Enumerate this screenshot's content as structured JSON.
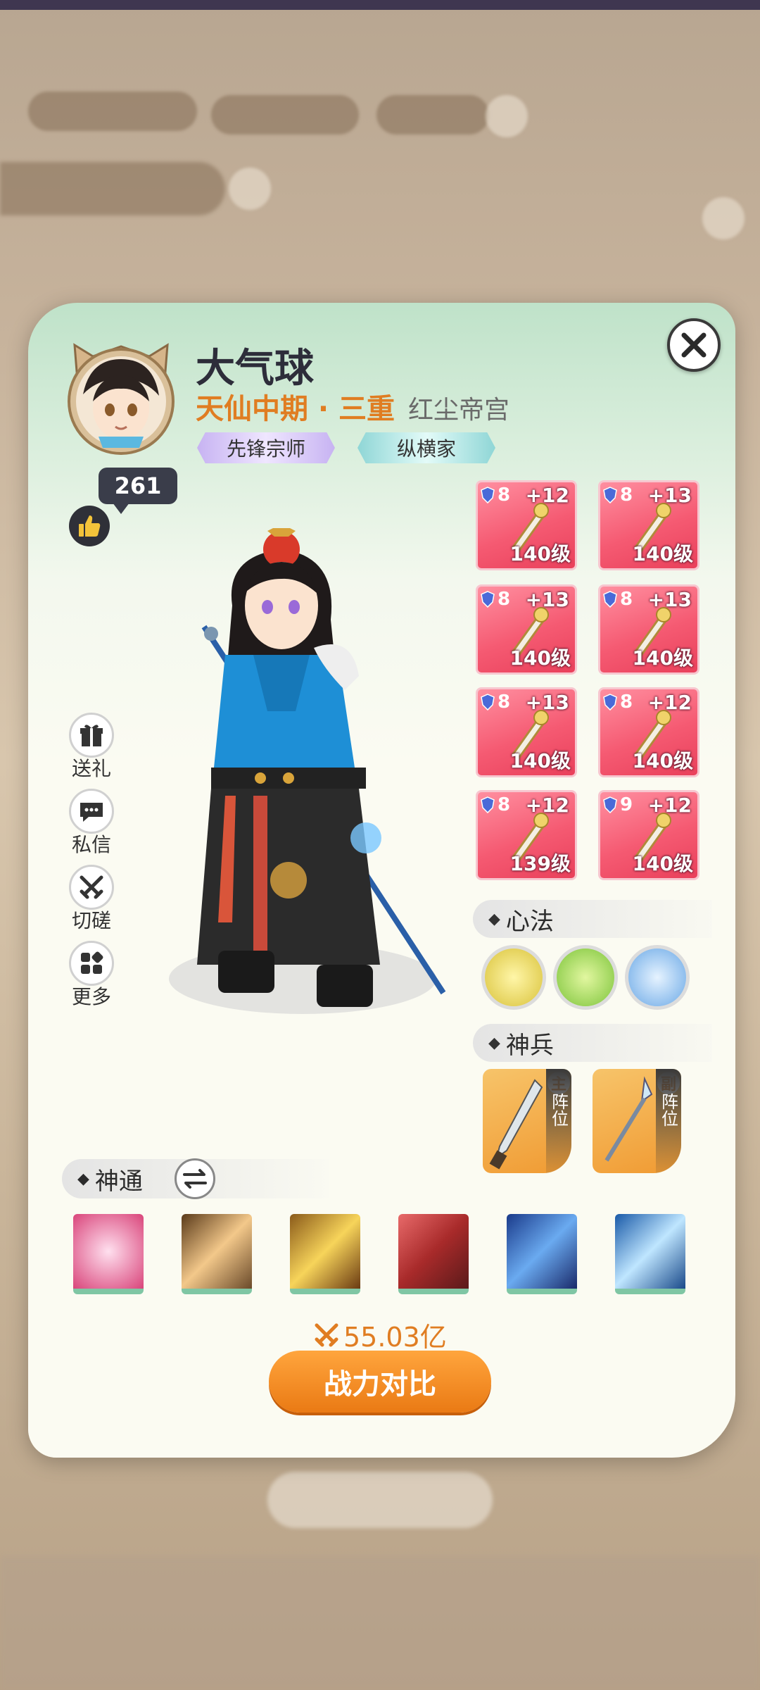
{
  "player": {
    "name": "大气球",
    "realm": "天仙中期 · 三重",
    "sect": "红尘帝宫",
    "tags": [
      "先锋宗师",
      "纵横家"
    ],
    "likes": "261"
  },
  "side_actions": [
    {
      "label": "送礼",
      "icon": "gift-icon"
    },
    {
      "label": "私信",
      "icon": "chat-icon"
    },
    {
      "label": "切磋",
      "icon": "crossed-swords-icon"
    },
    {
      "label": "更多",
      "icon": "more-grid-icon"
    }
  ],
  "equipment": [
    {
      "stars": "8",
      "plus": "+12",
      "level": "140级",
      "icon": "staff-icon"
    },
    {
      "stars": "8",
      "plus": "+13",
      "level": "140级",
      "icon": "crown-icon"
    },
    {
      "stars": "8",
      "plus": "+13",
      "level": "140级",
      "icon": "armor-icon"
    },
    {
      "stars": "8",
      "plus": "+13",
      "level": "140级",
      "icon": "robe-icon"
    },
    {
      "stars": "8",
      "plus": "+13",
      "level": "140级",
      "icon": "bracer-icon"
    },
    {
      "stars": "8",
      "plus": "+12",
      "level": "140级",
      "icon": "boots-icon"
    },
    {
      "stars": "8",
      "plus": "+12",
      "level": "139级",
      "icon": "ring-icon"
    },
    {
      "stars": "9",
      "plus": "+12",
      "level": "140级",
      "icon": "pendant-icon"
    }
  ],
  "sections": {
    "xinfa": "心法",
    "shenbing": "神兵",
    "shentong": "神通"
  },
  "weapons": [
    {
      "badge": "主",
      "label": "阵位",
      "icon": "blade-icon"
    },
    {
      "badge": "副",
      "label": "阵位",
      "icon": "spear-icon"
    }
  ],
  "power": {
    "value": "55.03亿"
  },
  "compare_button": "战力对比",
  "colors": {
    "accent": "#e07d22",
    "equip_bg": "#f55a72",
    "panel": "#fbfbf2"
  }
}
